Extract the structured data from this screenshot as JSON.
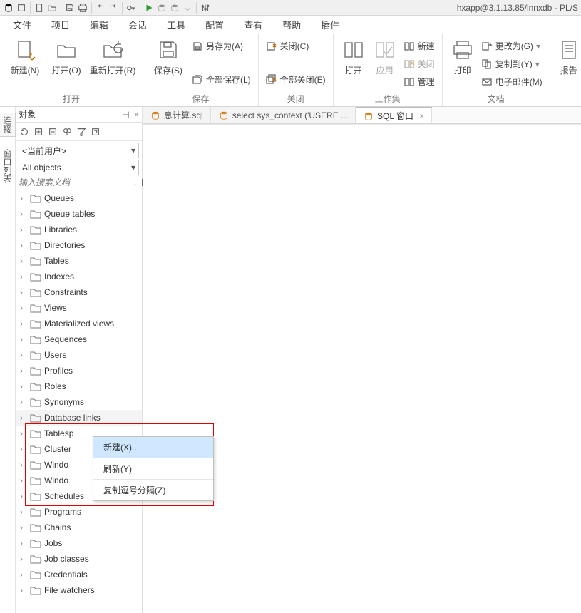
{
  "titlebar": {
    "title": "hxapp@3.1.13.85/lnnxdb - PL/S"
  },
  "menubar": [
    "文件",
    "项目",
    "编辑",
    "会话",
    "工具",
    "配置",
    "查看",
    "帮助",
    "插件"
  ],
  "ribbon": {
    "open": {
      "new": "新建(N)",
      "open": "打开(O)",
      "reopen": "重新打开(R)",
      "group": "打开"
    },
    "save": {
      "save": "保存(S)",
      "saveAs": "另存为(A)",
      "saveAll": "全部保存(L)",
      "group": "保存"
    },
    "close": {
      "close": "关闭(C)",
      "closeAll": "全部关闭(E)",
      "group": "关闭"
    },
    "workset": {
      "open": "打开",
      "apply": "应用",
      "new": "新建",
      "close": "关闭",
      "manage": "管理",
      "group": "工作集"
    },
    "doc": {
      "print": "打印",
      "changeTo": "更改为(G)",
      "copyTo": "复制到(Y)",
      "email": "电子邮件(M)",
      "group": "文档"
    },
    "report": {
      "report": "报告"
    }
  },
  "vtabs": {
    "a": "连接",
    "b": "窗口列表"
  },
  "panel": {
    "title": "对象",
    "userSel": "<当前用户>",
    "objSel": "All objects",
    "searchPlaceholder": "输入搜索文档..",
    "treeItems": [
      "Queues",
      "Queue tables",
      "Libraries",
      "Directories",
      "Tables",
      "Indexes",
      "Constraints",
      "Views",
      "Materialized views",
      "Sequences",
      "Users",
      "Profiles",
      "Roles",
      "Synonyms",
      "Database links",
      "Tablesp",
      "Cluster",
      "Windo",
      "Windo",
      "Schedules",
      "Programs",
      "Chains",
      "Jobs",
      "Job classes",
      "Credentials",
      "File watchers"
    ]
  },
  "editorTabs": {
    "a": "息计算.sql",
    "b": "select sys_context ('USERE ...",
    "c": "SQL 窗口"
  },
  "ctx": {
    "new": "新建(X)...",
    "refresh": "刷新(Y)",
    "copy": "复制逗号分隔(Z)"
  }
}
